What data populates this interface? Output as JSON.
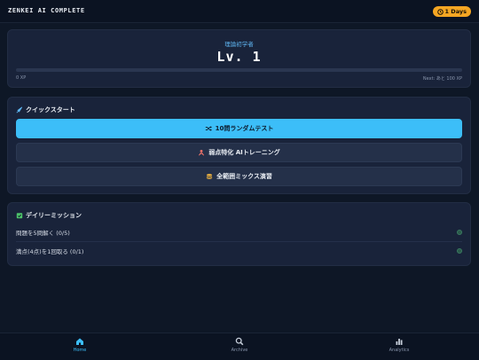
{
  "header": {
    "app_title": "ZENKEI AI COMPLETE",
    "streak_label": "1 Days",
    "streak_color": "#f5a623"
  },
  "level_card": {
    "rank": "理論初学者",
    "level": "Lv. 1",
    "xp_current": "0 XP",
    "xp_next": "Next: あと 100 XP",
    "xp_progress": 0
  },
  "quick_start": {
    "title": "クイックスタート",
    "icon": "rocket-icon",
    "buttons": [
      {
        "label": "10問ランダムテスト",
        "icon": "shuffle-icon",
        "accent": "#3cbef8"
      },
      {
        "label": "弱点特化 AIトレーニング",
        "icon": "target-person-icon"
      },
      {
        "label": "全範囲ミックス演習",
        "icon": "stack-icon"
      }
    ]
  },
  "daily": {
    "title": "デイリーミッション",
    "icon": "calendar-check-icon",
    "missions": [
      {
        "label": "問題を5問解く (0/5)"
      },
      {
        "label": "満点(4点)を1回取る (0/1)"
      }
    ]
  },
  "nav": {
    "items": [
      {
        "label": "Home",
        "icon": "home-icon",
        "active": true
      },
      {
        "label": "Archive",
        "icon": "search-icon",
        "active": false
      },
      {
        "label": "Analytics",
        "icon": "bar-chart-icon",
        "active": false
      }
    ]
  }
}
